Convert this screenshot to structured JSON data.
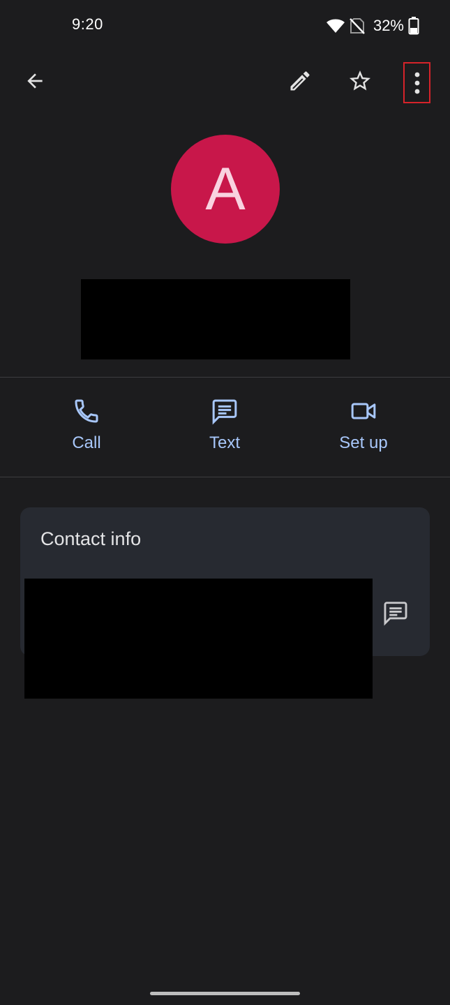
{
  "status_bar": {
    "time": "9:20",
    "battery_percent": "32%"
  },
  "avatar": {
    "initial": "A",
    "color": "#c8174a"
  },
  "actions": {
    "call_label": "Call",
    "text_label": "Text",
    "setup_label": "Set up"
  },
  "contact_info": {
    "title": "Contact info"
  },
  "colors": {
    "accent": "#a8c7fa",
    "highlight_box": "#d6232a"
  }
}
